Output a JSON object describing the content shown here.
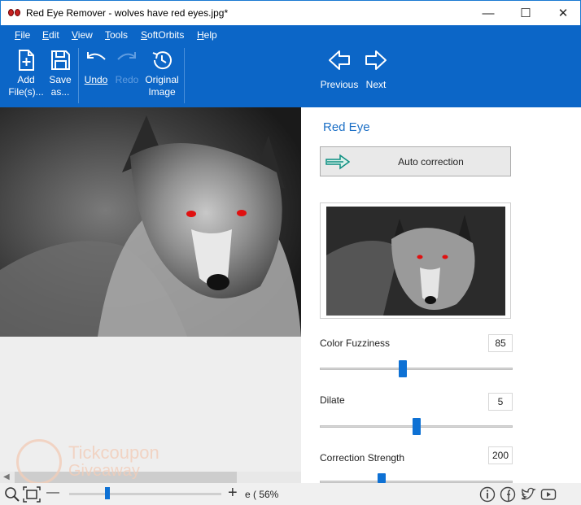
{
  "window": {
    "title": "Red Eye Remover - wolves have red eyes.jpg*",
    "minimize": "—",
    "maximize": "☐",
    "close": "✕"
  },
  "menu": [
    "File",
    "Edit",
    "View",
    "Tools",
    "SoftOrbits",
    "Help"
  ],
  "toolbar": {
    "add_files": [
      "Add",
      "File(s)..."
    ],
    "save_as": [
      "Save",
      "as..."
    ],
    "undo": "Undo",
    "redo": "Redo",
    "original_image": [
      "Original",
      "Image"
    ],
    "previous": "Previous",
    "next": "Next"
  },
  "panel": {
    "title": "Red Eye",
    "auto_correction": "Auto correction",
    "params": [
      {
        "label": "Color Fuzziness",
        "value": "85",
        "level": 0.43
      },
      {
        "label": "Dilate",
        "value": "5",
        "level": 0.5
      },
      {
        "label": "Correction Strength",
        "value": "200",
        "level": 0.32
      }
    ]
  },
  "watermark": {
    "line1": "Tickcoupon",
    "line2": "Giveaway"
  },
  "status": {
    "zoom_text": "e ( 56%",
    "zoom_level": 0.25
  },
  "colors": {
    "ribbon": "#0c66c7",
    "accent": "#0e71d4",
    "red_eye": "#e01010"
  },
  "icons": {
    "app": "red-eyes-icon",
    "add_files": "add-file-icon",
    "save": "floppy-disk-icon",
    "undo": "undo-arrow-icon",
    "redo": "redo-arrow-icon",
    "original": "history-clock-icon",
    "previous": "left-arrow-icon",
    "next": "right-arrow-icon",
    "auto": "double-arrow-icon"
  }
}
